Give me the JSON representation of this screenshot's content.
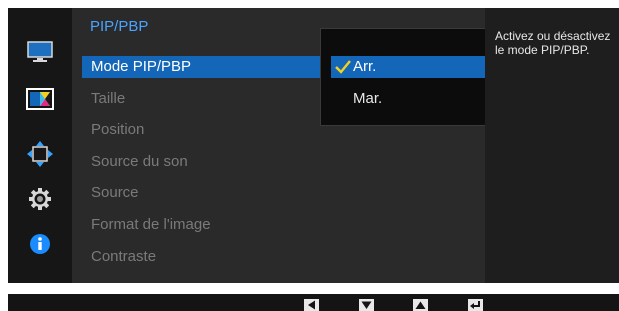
{
  "menu": {
    "title": "PIP/PBP",
    "items": [
      {
        "label": "Mode PIP/PBP",
        "selected": true
      },
      {
        "label": "Taille"
      },
      {
        "label": "Position"
      },
      {
        "label": "Source du son"
      },
      {
        "label": "Source"
      },
      {
        "label": "Format de l'image"
      },
      {
        "label": "Contraste"
      }
    ]
  },
  "submenu": {
    "options": [
      {
        "label": "Arr.",
        "selected": true
      },
      {
        "label": "Mar."
      }
    ]
  },
  "help": {
    "text": "Activez ou désactivez le mode PIP/PBP."
  },
  "sidebar": {
    "icons": [
      "picture-icon",
      "color-icon",
      "size-position-icon",
      "settings-icon",
      "information-icon"
    ],
    "active": "color-icon"
  },
  "colors": {
    "accent": "#1466b8",
    "title": "#4aa3ff",
    "check": "#f2d21e",
    "info": "#1a8cff"
  },
  "bottom_keys": [
    "left-key-icon",
    "down-key-icon",
    "up-key-icon",
    "enter-key-icon"
  ]
}
